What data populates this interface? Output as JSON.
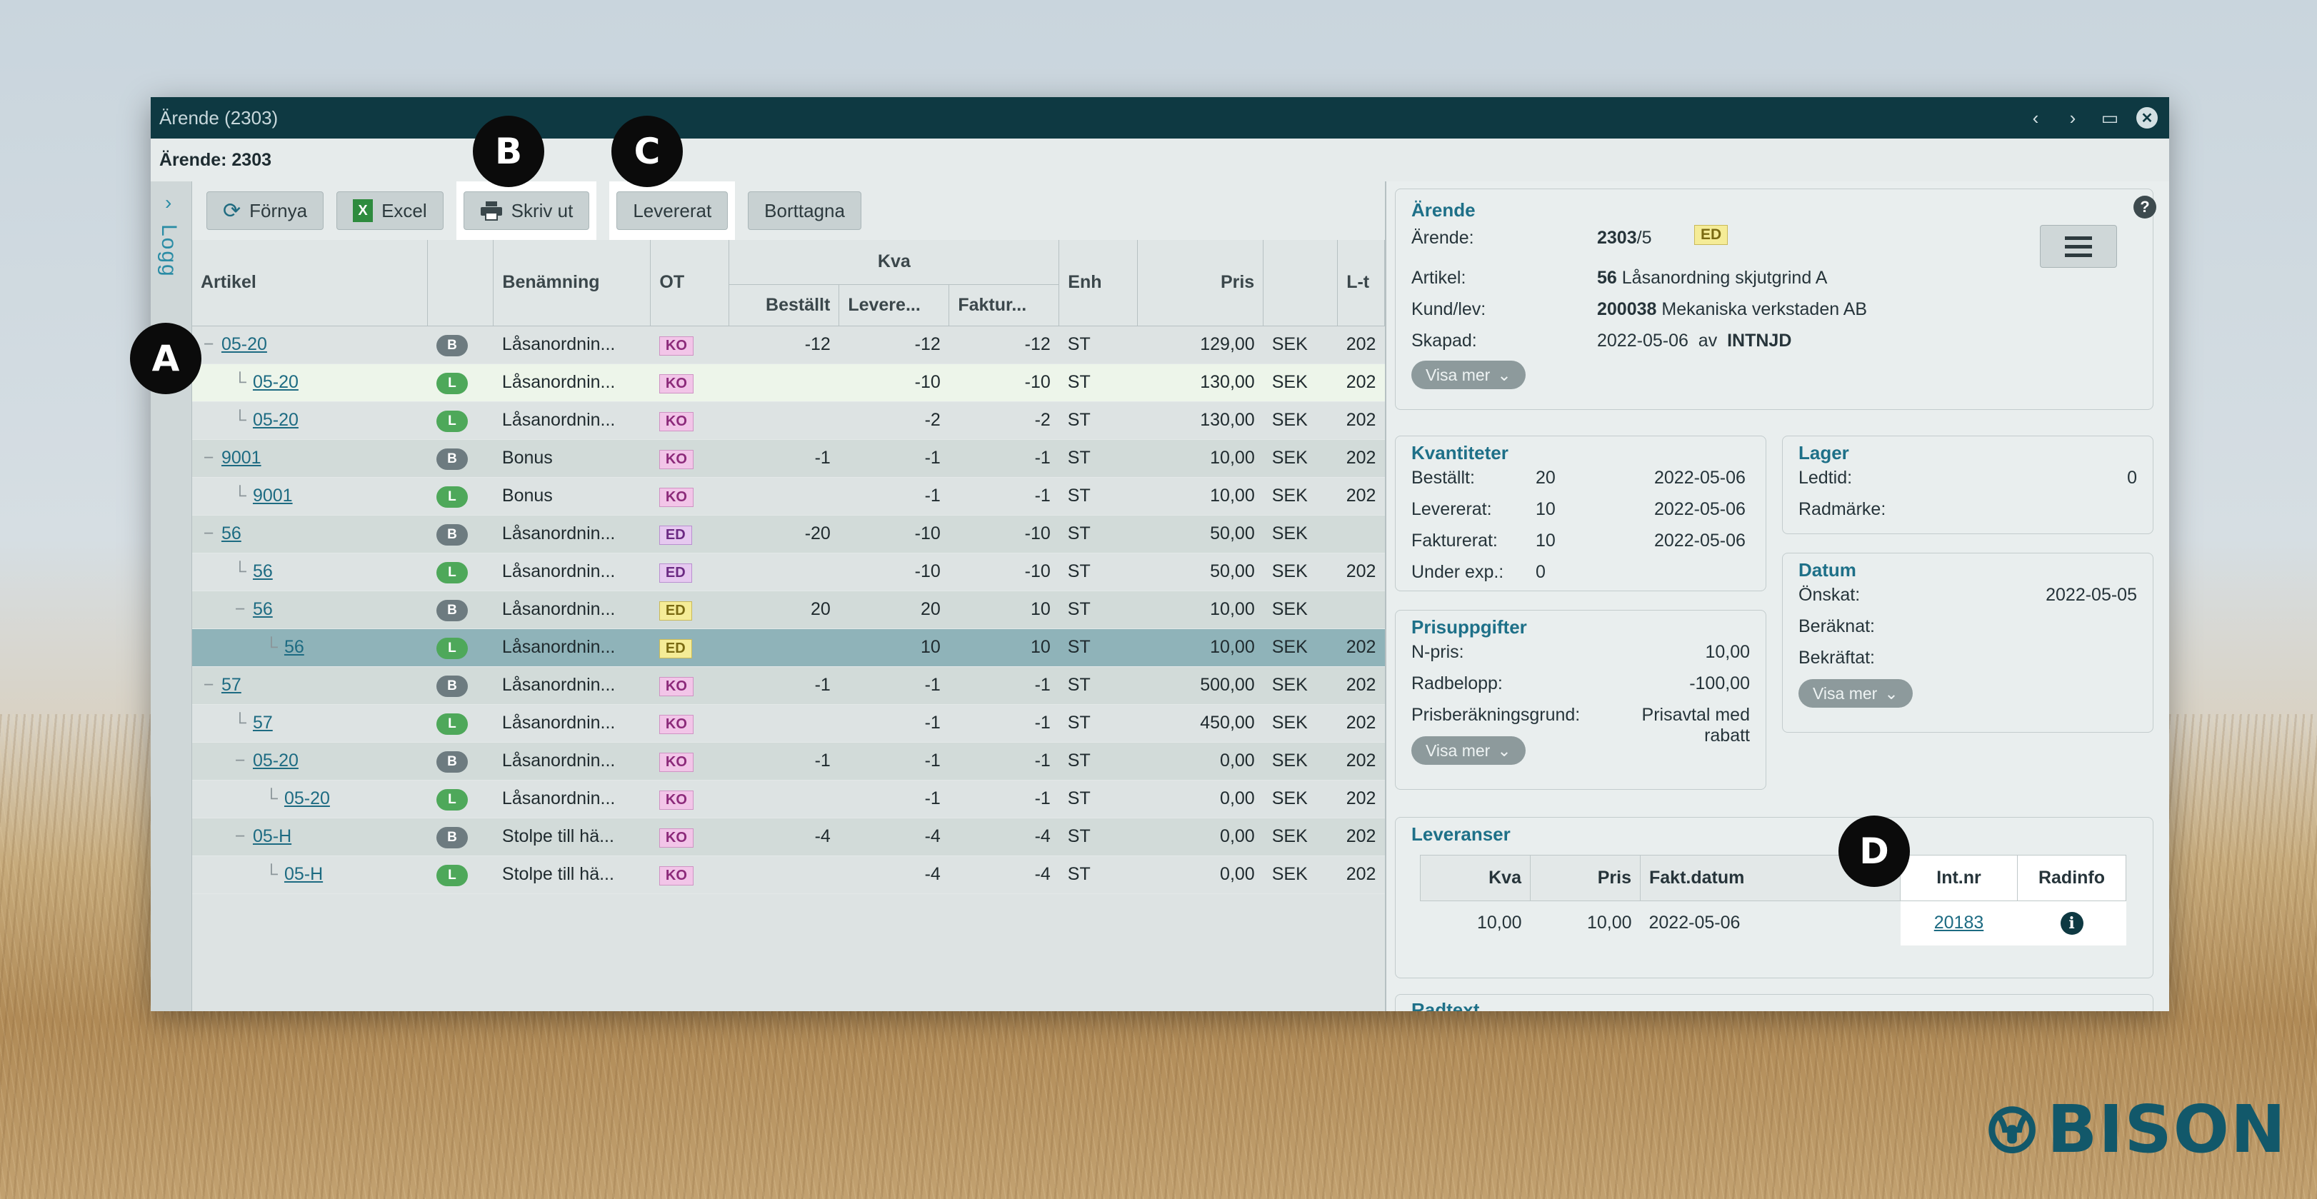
{
  "window": {
    "title": "Ärende (2303)",
    "subtitle": "Ärende: 2303"
  },
  "sidebar": {
    "label": "Logg",
    "chevron": "›"
  },
  "toolbar": {
    "refresh": "Förnya",
    "excel": "Excel",
    "print": "Skriv ut",
    "delivered": "Levererat",
    "removed": "Borttagna"
  },
  "table": {
    "headers": {
      "artikel": "Artikel",
      "benamning": "Benämning",
      "ot": "OT",
      "kva": "Kva",
      "bestallt": "Beställt",
      "levererat": "Levere...",
      "fakturerat": "Faktur...",
      "enh": "Enh",
      "pris": "Pris",
      "lt": "L-t"
    },
    "rows": [
      {
        "art": "05-20",
        "level": 0,
        "tree": "−",
        "type": "B",
        "ben": "Låsanordnin...",
        "ot": "KO",
        "best": "-12",
        "lev": "-12",
        "fakt": "-12",
        "enh": "ST",
        "pris": "129,00",
        "cur": "SEK",
        "lt": "202"
      },
      {
        "art": "05-20",
        "level": 1,
        "tree": "└",
        "type": "L",
        "ben": "Låsanordnin...",
        "ot": "KO",
        "best": "",
        "lev": "-10",
        "fakt": "-10",
        "enh": "ST",
        "pris": "130,00",
        "cur": "SEK",
        "lt": "202"
      },
      {
        "art": "05-20",
        "level": 1,
        "tree": "└",
        "type": "L",
        "ben": "Låsanordnin...",
        "ot": "KO",
        "best": "",
        "lev": "-2",
        "fakt": "-2",
        "enh": "ST",
        "pris": "130,00",
        "cur": "SEK",
        "lt": "202"
      },
      {
        "art": "9001",
        "level": 0,
        "tree": "−",
        "type": "B",
        "ben": "Bonus",
        "ot": "KO",
        "best": "-1",
        "lev": "-1",
        "fakt": "-1",
        "enh": "ST",
        "pris": "10,00",
        "cur": "SEK",
        "lt": "202"
      },
      {
        "art": "9001",
        "level": 1,
        "tree": "└",
        "type": "L",
        "ben": "Bonus",
        "ot": "KO",
        "best": "",
        "lev": "-1",
        "fakt": "-1",
        "enh": "ST",
        "pris": "10,00",
        "cur": "SEK",
        "lt": "202"
      },
      {
        "art": "56",
        "level": 0,
        "tree": "−",
        "type": "B",
        "ben": "Låsanordnin...",
        "ot": "ED",
        "best": "-20",
        "lev": "-10",
        "fakt": "-10",
        "enh": "ST",
        "pris": "50,00",
        "cur": "SEK",
        "lt": ""
      },
      {
        "art": "56",
        "level": 1,
        "tree": "└",
        "type": "L",
        "ben": "Låsanordnin...",
        "ot": "ED",
        "best": "",
        "lev": "-10",
        "fakt": "-10",
        "enh": "ST",
        "pris": "50,00",
        "cur": "SEK",
        "lt": "202"
      },
      {
        "art": "56",
        "level": 1,
        "tree": "−",
        "type": "B",
        "ben": "Låsanordnin...",
        "ot": "ED",
        "best": "20",
        "lev": "20",
        "fakt": "10",
        "enh": "ST",
        "pris": "10,00",
        "cur": "SEK",
        "lt": ""
      },
      {
        "art": "56",
        "level": 2,
        "tree": "└",
        "type": "L",
        "ben": "Låsanordnin...",
        "ot": "ED",
        "best": "",
        "lev": "10",
        "fakt": "10",
        "enh": "ST",
        "pris": "10,00",
        "cur": "SEK",
        "lt": "202"
      },
      {
        "art": "57",
        "level": 0,
        "tree": "−",
        "type": "B",
        "ben": "Låsanordnin...",
        "ot": "KO",
        "best": "-1",
        "lev": "-1",
        "fakt": "-1",
        "enh": "ST",
        "pris": "500,00",
        "cur": "SEK",
        "lt": "202"
      },
      {
        "art": "57",
        "level": 1,
        "tree": "└",
        "type": "L",
        "ben": "Låsanordnin...",
        "ot": "KO",
        "best": "",
        "lev": "-1",
        "fakt": "-1",
        "enh": "ST",
        "pris": "450,00",
        "cur": "SEK",
        "lt": "202"
      },
      {
        "art": "05-20",
        "level": 1,
        "tree": "−",
        "type": "B",
        "ben": "Låsanordnin...",
        "ot": "KO",
        "best": "-1",
        "lev": "-1",
        "fakt": "-1",
        "enh": "ST",
        "pris": "0,00",
        "cur": "SEK",
        "lt": "202"
      },
      {
        "art": "05-20",
        "level": 2,
        "tree": "└",
        "type": "L",
        "ben": "Låsanordnin...",
        "ot": "KO",
        "best": "",
        "lev": "-1",
        "fakt": "-1",
        "enh": "ST",
        "pris": "0,00",
        "cur": "SEK",
        "lt": "202"
      },
      {
        "art": "05-H",
        "level": 1,
        "tree": "−",
        "type": "B",
        "ben": "Stolpe till hä...",
        "ot": "KO",
        "best": "-4",
        "lev": "-4",
        "fakt": "-4",
        "enh": "ST",
        "pris": "0,00",
        "cur": "SEK",
        "lt": "202"
      },
      {
        "art": "05-H",
        "level": 2,
        "tree": "└",
        "type": "L",
        "ben": "Stolpe till hä...",
        "ot": "KO",
        "best": "",
        "lev": "-4",
        "fakt": "-4",
        "enh": "ST",
        "pris": "0,00",
        "cur": "SEK",
        "lt": "202"
      }
    ]
  },
  "detail": {
    "arende": {
      "title": "Ärende",
      "l_arende": "Ärende:",
      "nr": "2303",
      "suffix": "/5",
      "tag": "ED",
      "l_artikel": "Artikel:",
      "artikel_nr": "56",
      "artikel_namn": "Låsanordning skjutgrind A",
      "l_kund": "Kund/lev:",
      "kund_nr": "200038",
      "kund_namn": "Mekaniska verkstaden AB",
      "l_skapad": "Skapad:",
      "skapad_datum": "2022-05-06",
      "av": "av",
      "skapad_av": "INTNJD",
      "more": "Visa mer"
    },
    "kvantiteter": {
      "title": "Kvantiteter",
      "l_best": "Beställt:",
      "best": "20",
      "best_d": "2022-05-06",
      "l_lev": "Levererat:",
      "lev": "10",
      "lev_d": "2022-05-06",
      "l_fakt": "Fakturerat:",
      "fakt": "10",
      "fakt_d": "2022-05-06",
      "l_under": "Under exp.:",
      "under": "0"
    },
    "lager": {
      "title": "Lager",
      "l_ledtid": "Ledtid:",
      "ledtid": "0",
      "l_radmarke": "Radmärke:"
    },
    "datum": {
      "title": "Datum",
      "l_onskat": "Önskat:",
      "onskat": "2022-05-05",
      "l_beraknat": "Beräknat:",
      "l_bekraftat": "Bekräftat:",
      "more": "Visa mer"
    },
    "pris": {
      "title": "Prisuppgifter",
      "l_npris": "N-pris:",
      "npris": "10,00",
      "l_radbelopp": "Radbelopp:",
      "radbelopp": "-100,00",
      "l_grund": "Prisberäkningsgrund:",
      "grund1": "Prisavtal med",
      "grund2": "rabatt",
      "more": "Visa mer"
    },
    "leveranser": {
      "title": "Leveranser",
      "headers": {
        "kva": "Kva",
        "pris": "Pris",
        "fakt": "Fakt.datum",
        "intnr": "Int.nr",
        "radinfo": "Radinfo"
      },
      "row": {
        "kva": "10,00",
        "pris": "10,00",
        "fakt": "2022-05-06",
        "intnr": "20183"
      }
    },
    "radtext": {
      "title": "Radtext"
    }
  },
  "callouts": {
    "a": "A",
    "b": "B",
    "c": "C",
    "d": "D"
  },
  "brand": {
    "name": "BISON",
    "color": "#12586a"
  },
  "colors": {
    "titlebar": "#0e3942",
    "accent": "#1e7088",
    "badge_B": "#6d7b80",
    "badge_L": "#4ea85a"
  }
}
